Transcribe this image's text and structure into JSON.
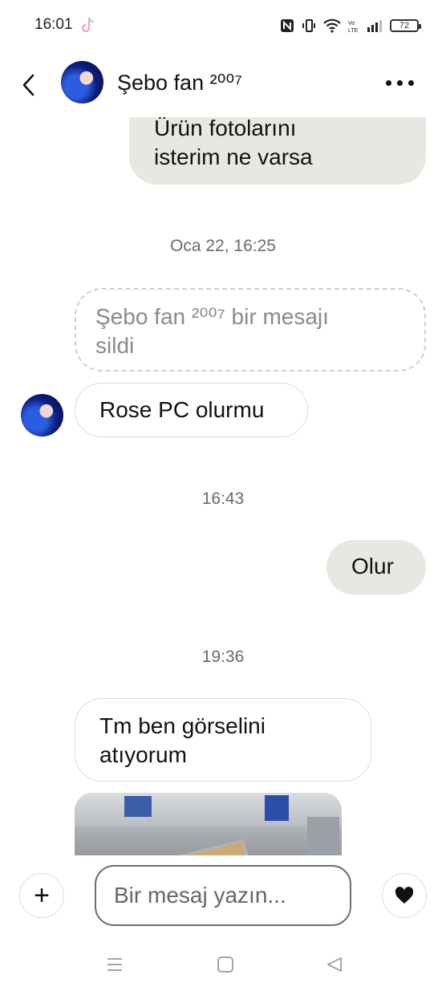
{
  "status_bar": {
    "time": "16:01",
    "battery": "72",
    "icons": [
      "tiktok-icon",
      "nfc-icon",
      "vibrate-icon",
      "wifi-icon",
      "volte-icon",
      "signal-icon",
      "battery-icon"
    ]
  },
  "header": {
    "name": "Şebo fan ²⁰⁰⁷",
    "back_icon": "chevron-left-icon",
    "more_icon": "more-horizontal-icon"
  },
  "messages": {
    "m1": {
      "direction": "outgoing",
      "line1": "Ürün fotolarını",
      "line2": "isterim ne varsa"
    },
    "ts1": "Oca 22, 16:25",
    "m2": {
      "direction": "incoming",
      "type": "deleted",
      "line1": "Şebo fan ²⁰⁰⁷ bir mesajı",
      "line2": "sildi"
    },
    "m3": {
      "direction": "incoming",
      "text": "Rose PC olurmu"
    },
    "ts2": "16:43",
    "m4": {
      "direction": "outgoing",
      "text": "Olur"
    },
    "ts3": "19:36",
    "m5": {
      "direction": "incoming",
      "line1": "Tm ben görselini",
      "line2": "atıyorum"
    },
    "m6": {
      "direction": "incoming",
      "type": "photo"
    }
  },
  "composer": {
    "placeholder": "Bir mesaj yazın...",
    "add_icon": "plus-icon",
    "like_icon": "heart-icon"
  },
  "colors": {
    "outgoing_bubble": "#e8e8e3",
    "incoming_border": "#dcdcdc",
    "timestamp": "#6b6b6b"
  }
}
